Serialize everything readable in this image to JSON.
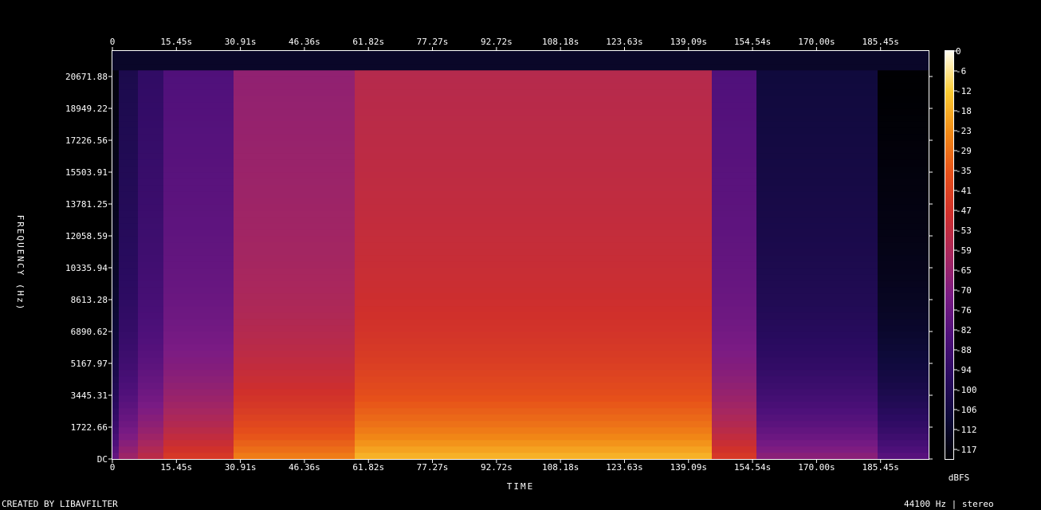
{
  "chart_data": {
    "type": "heatmap",
    "subtype": "spectrogram",
    "title": "",
    "xlabel": "TIME",
    "ylabel": "FREQUENCY (Hz)",
    "x_ticks": [
      "0",
      "15.45s",
      "30.91s",
      "46.36s",
      "61.82s",
      "77.27s",
      "92.72s",
      "108.18s",
      "123.63s",
      "139.09s",
      "154.54s",
      "170.00s",
      "185.45s"
    ],
    "y_ticks": [
      "DC",
      "1722.66",
      "3445.31",
      "5167.97",
      "6890.62",
      "8613.28",
      "10335.94",
      "12058.59",
      "13781.25",
      "15503.91",
      "17226.56",
      "18949.22",
      "20671.88"
    ],
    "colorbar": {
      "label": "dBFS",
      "ticks": [
        "0",
        "-6",
        "-12",
        "-18",
        "-23",
        "-29",
        "-35",
        "-41",
        "-47",
        "-53",
        "-59",
        "-65",
        "-70",
        "-76",
        "-82",
        "-88",
        "-94",
        "-100",
        "-106",
        "-112",
        "-117"
      ],
      "range": [
        -117,
        0
      ]
    },
    "time_range_s": [
      0,
      197
    ],
    "freq_range_hz": [
      0,
      22050
    ],
    "intensity_regions": [
      {
        "start_s": 0,
        "end_s": 2,
        "level_dbfs": -105
      },
      {
        "start_s": 2,
        "end_s": 6,
        "level_dbfs": -90
      },
      {
        "start_s": 6,
        "end_s": 12,
        "level_dbfs": -82
      },
      {
        "start_s": 12,
        "end_s": 30,
        "level_dbfs": -72
      },
      {
        "start_s": 30,
        "end_s": 58,
        "level_dbfs": -55
      },
      {
        "start_s": 58,
        "end_s": 145,
        "level_dbfs": -45
      },
      {
        "start_s": 145,
        "end_s": 155,
        "level_dbfs": -72
      },
      {
        "start_s": 155,
        "end_s": 185,
        "level_dbfs": -95
      },
      {
        "start_s": 185,
        "end_s": 197,
        "level_dbfs": -108
      }
    ],
    "grid": false
  },
  "footer": {
    "left": "CREATED BY LIBAVFILTER",
    "right": "44100 Hz | stereo"
  },
  "colors": {
    "background": "#000000",
    "text": "#ffffff",
    "colormap": [
      "#000003",
      "#0e0a3a",
      "#3b0f70",
      "#6a1a82",
      "#9c2f6c",
      "#c93a3a",
      "#e5401b",
      "#f06a12",
      "#f7a01b",
      "#fbd23a",
      "#fffbe8"
    ]
  }
}
